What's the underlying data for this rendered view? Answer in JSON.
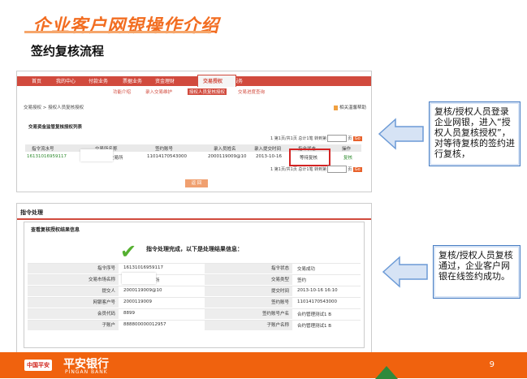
{
  "slide": {
    "title": "企业客户网银操作介绍",
    "subtitle": "签约复核流程",
    "page_number": "9"
  },
  "screen1": {
    "nav_items": [
      "首页",
      "我的中心",
      "付款业务",
      "票据业务",
      "资金理财",
      "交易授权",
      "客户服务"
    ],
    "nav_active": "交易授权",
    "subnav_items": [
      "功能介绍",
      "录入交易维护",
      "授权人员复核授权",
      "交易进度查询"
    ],
    "subnav_active": "授权人员复核授权",
    "breadcrumb": "交易授权 > 授权人员复核授权",
    "help_label": "相关温馨帮助",
    "panel_title": "交易资金监管复核授权列表",
    "pager_text": "1 第1页/共1页 总计1笔 转到第",
    "pager_suffix": "页",
    "go_label": "Go",
    "columns": [
      "指令流水号",
      "交易所名称",
      "签约账号",
      "录入员姓名",
      "录入提交时间",
      "指令状态",
      "操作"
    ],
    "row": {
      "serial": "16131016959117",
      "exchange": "交易所",
      "account": "11014170543000",
      "operator": "2000119009@10",
      "submit_time": "2013-10-16",
      "status": "等待复核",
      "action": "复核"
    },
    "back_label": "返 回"
  },
  "screen2": {
    "title": "指令处理",
    "section_title": "查看复核授权结果信息",
    "done_message": "指令处理完成，以下是处理结果信息：",
    "rows": [
      {
        "l1": "指令序号",
        "v1": "16131016959117",
        "l2": "指令状态",
        "v2": "交易成功"
      },
      {
        "l1": "交易市场名称",
        "v1": "交易所",
        "l2": "交易类型",
        "v2": "签约"
      },
      {
        "l1": "提交人",
        "v1": "2000119009@10",
        "l2": "提交时间",
        "v2": "2013-10-16 16:10"
      },
      {
        "l1": "网银客户号",
        "v1": "2000119009",
        "l2": "签约账号",
        "v2": "11014170543000"
      },
      {
        "l1": "会员代码",
        "v1": "8899",
        "l2": "签约账号户名",
        "v2": "合约管理测试1 B"
      },
      {
        "l1": "子账户",
        "v1": "888800000012957",
        "l2": "子账户名称",
        "v2": "合约管理测试1 B"
      }
    ],
    "back_label": "返 回"
  },
  "callouts": {
    "first": "复核/授权人员登录企业网银，进入“授权人员复核授权”，对等待复核的签约进行复核，",
    "second": "复核/授权人员复核通过，企业客户网银在线签约成功。"
  },
  "footer": {
    "logo_text": "中国平安",
    "bank_name_cn": "平安银行",
    "bank_name_en": "PINGAN BANK"
  },
  "colors": {
    "accent_orange": "#f26d21",
    "nav_red": "#d14a3d",
    "footer_orange": "#f0620e",
    "arrow_blue": "#6b9ad6",
    "check_green": "#55b030"
  }
}
